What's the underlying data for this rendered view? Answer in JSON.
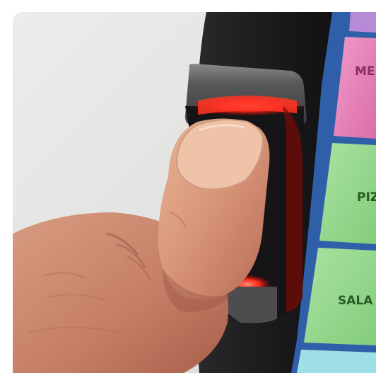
{
  "scene": {
    "subject": "thumb-on-fingerprint-reader",
    "reader_light_color": "#ff2a1a",
    "device_color": "#1c1c1e",
    "background_color": "#e3e3e1"
  },
  "screen_buttons": [
    {
      "label": "ME",
      "color": "#e582b8",
      "text_color": "#8a2f63"
    },
    {
      "label": "PIZ",
      "color": "#97d98f",
      "text_color": "#2a5a23"
    },
    {
      "label": "SALA",
      "color": "#97d98f",
      "text_color": "#2a5a23"
    }
  ],
  "icon_names": [
    "fingerprint-reader-icon",
    "thumb-icon"
  ]
}
